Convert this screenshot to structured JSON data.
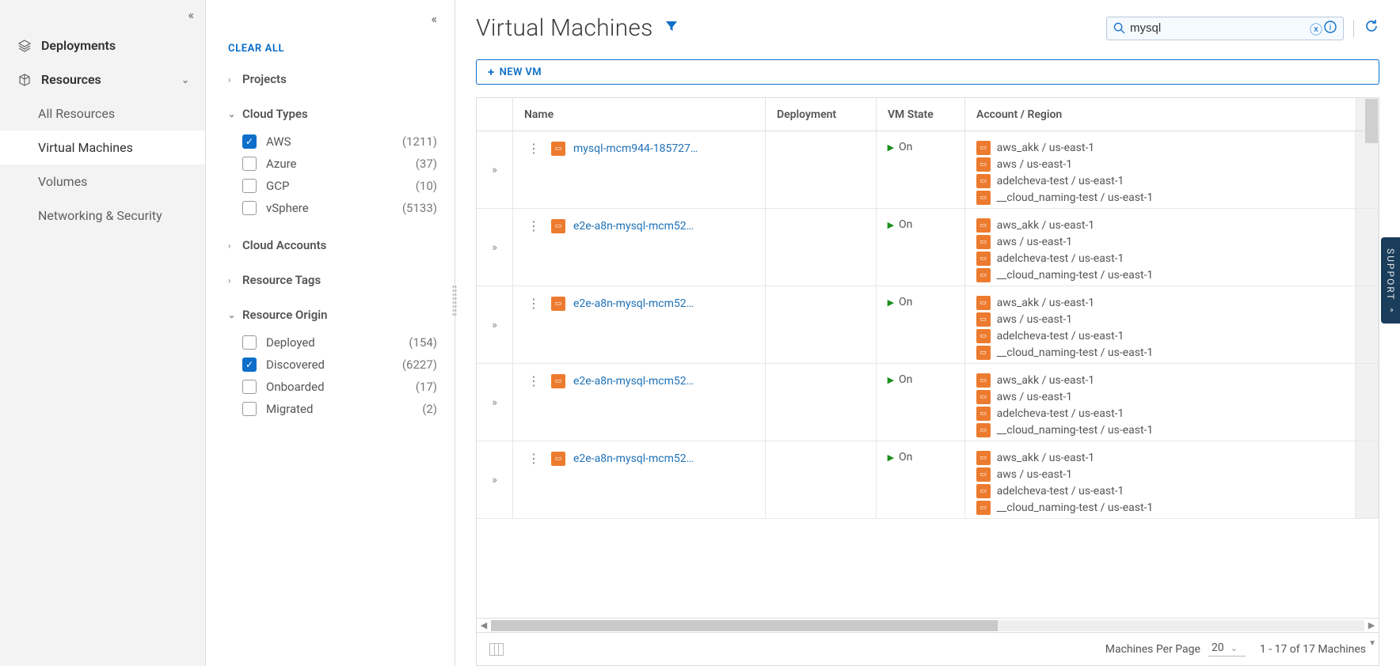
{
  "nav": {
    "deployments": "Deployments",
    "resources": "Resources",
    "subs": {
      "all": "All Resources",
      "vm": "Virtual Machines",
      "vol": "Volumes",
      "net": "Networking & Security"
    }
  },
  "filters": {
    "clear": "CLEAR ALL",
    "groups": {
      "projects": "Projects",
      "cloud_types": "Cloud Types",
      "cloud_accounts": "Cloud Accounts",
      "resource_tags": "Resource Tags",
      "resource_origin": "Resource Origin"
    },
    "cloud_types": [
      {
        "label": "AWS",
        "count": "(1211)",
        "checked": true
      },
      {
        "label": "Azure",
        "count": "(37)"
      },
      {
        "label": "GCP",
        "count": "(10)"
      },
      {
        "label": "vSphere",
        "count": "(5133)"
      }
    ],
    "resource_origin": [
      {
        "label": "Deployed",
        "count": "(154)"
      },
      {
        "label": "Discovered",
        "count": "(6227)",
        "checked": true
      },
      {
        "label": "Onboarded",
        "count": "(17)"
      },
      {
        "label": "Migrated",
        "count": "(2)"
      }
    ]
  },
  "page": {
    "title": "Virtual Machines",
    "new_vm": "NEW VM",
    "search_value": "mysql"
  },
  "grid": {
    "cols": {
      "name": "Name",
      "dep": "Deployment",
      "state": "VM State",
      "acct": "Account / Region"
    },
    "state_on": "On",
    "accounts": [
      "aws_akk / us-east-1",
      "aws / us-east-1",
      "adelcheva-test / us-east-1",
      "__cloud_naming-test / us-east-1"
    ],
    "rows": [
      {
        "name": "mysql-mcm944-185727…"
      },
      {
        "name": "e2e-a8n-mysql-mcm52…"
      },
      {
        "name": "e2e-a8n-mysql-mcm52…"
      },
      {
        "name": "e2e-a8n-mysql-mcm52…"
      },
      {
        "name": "e2e-a8n-mysql-mcm52…"
      }
    ]
  },
  "footer": {
    "pp_label": "Machines Per Page",
    "pp_value": "20",
    "range": "1 - 17 of 17 Machines"
  },
  "support": "SUPPORT"
}
